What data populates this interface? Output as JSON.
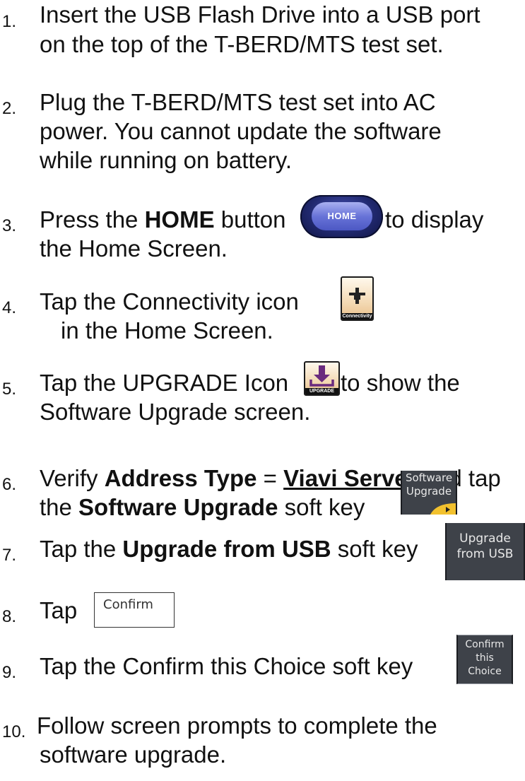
{
  "steps": [
    {
      "num": "1.",
      "lines": [
        "Insert the USB Flash Drive into a USB port",
        "on the top of the T-BERD/MTS test set."
      ]
    },
    {
      "num": "2.",
      "lines": [
        "Plug the T-BERD/MTS test set into AC",
        "power.  You cannot update the software",
        "while running on battery."
      ]
    },
    {
      "num": "3.",
      "pre": "Press the ",
      "bold": "HOME",
      "mid": " button",
      "post": " to display",
      "line2": "the Home Screen."
    },
    {
      "num": "4.",
      "line1": "Tap the Connectivity icon",
      "line2": "in the Home Screen."
    },
    {
      "num": "5.",
      "pre": "Tap the UPGRADE Icon",
      "post": " to show the",
      "line2": "Software Upgrade screen."
    },
    {
      "num": "6.",
      "a": "Verify ",
      "b": "Address Type",
      "c": " = ",
      "d": "Viavi Server",
      "e": " and tap",
      "f": "the ",
      "g": "Software Upgrade",
      "h": " soft key"
    },
    {
      "num": "7.",
      "pre": "Tap the ",
      "bold": "Upgrade from USB",
      "post": " soft key"
    },
    {
      "num": "8.",
      "text": "Tap"
    },
    {
      "num": "9.",
      "text": "Tap the Confirm this Choice soft key"
    },
    {
      "num": "10.",
      "lines": [
        "Follow screen prompts to complete the",
        "software upgrade."
      ]
    }
  ],
  "icons": {
    "home_button_label": "HOME",
    "connectivity_caption": "Connectivity",
    "upgrade_caption": "UPGRADE"
  },
  "softkeys": {
    "software_upgrade": [
      "Software",
      "Upgrade"
    ],
    "upgrade_from_usb": [
      "Upgrade",
      "from USB"
    ],
    "confirm": "Confirm",
    "confirm_choice": [
      "Confirm",
      "this",
      "Choice"
    ]
  }
}
